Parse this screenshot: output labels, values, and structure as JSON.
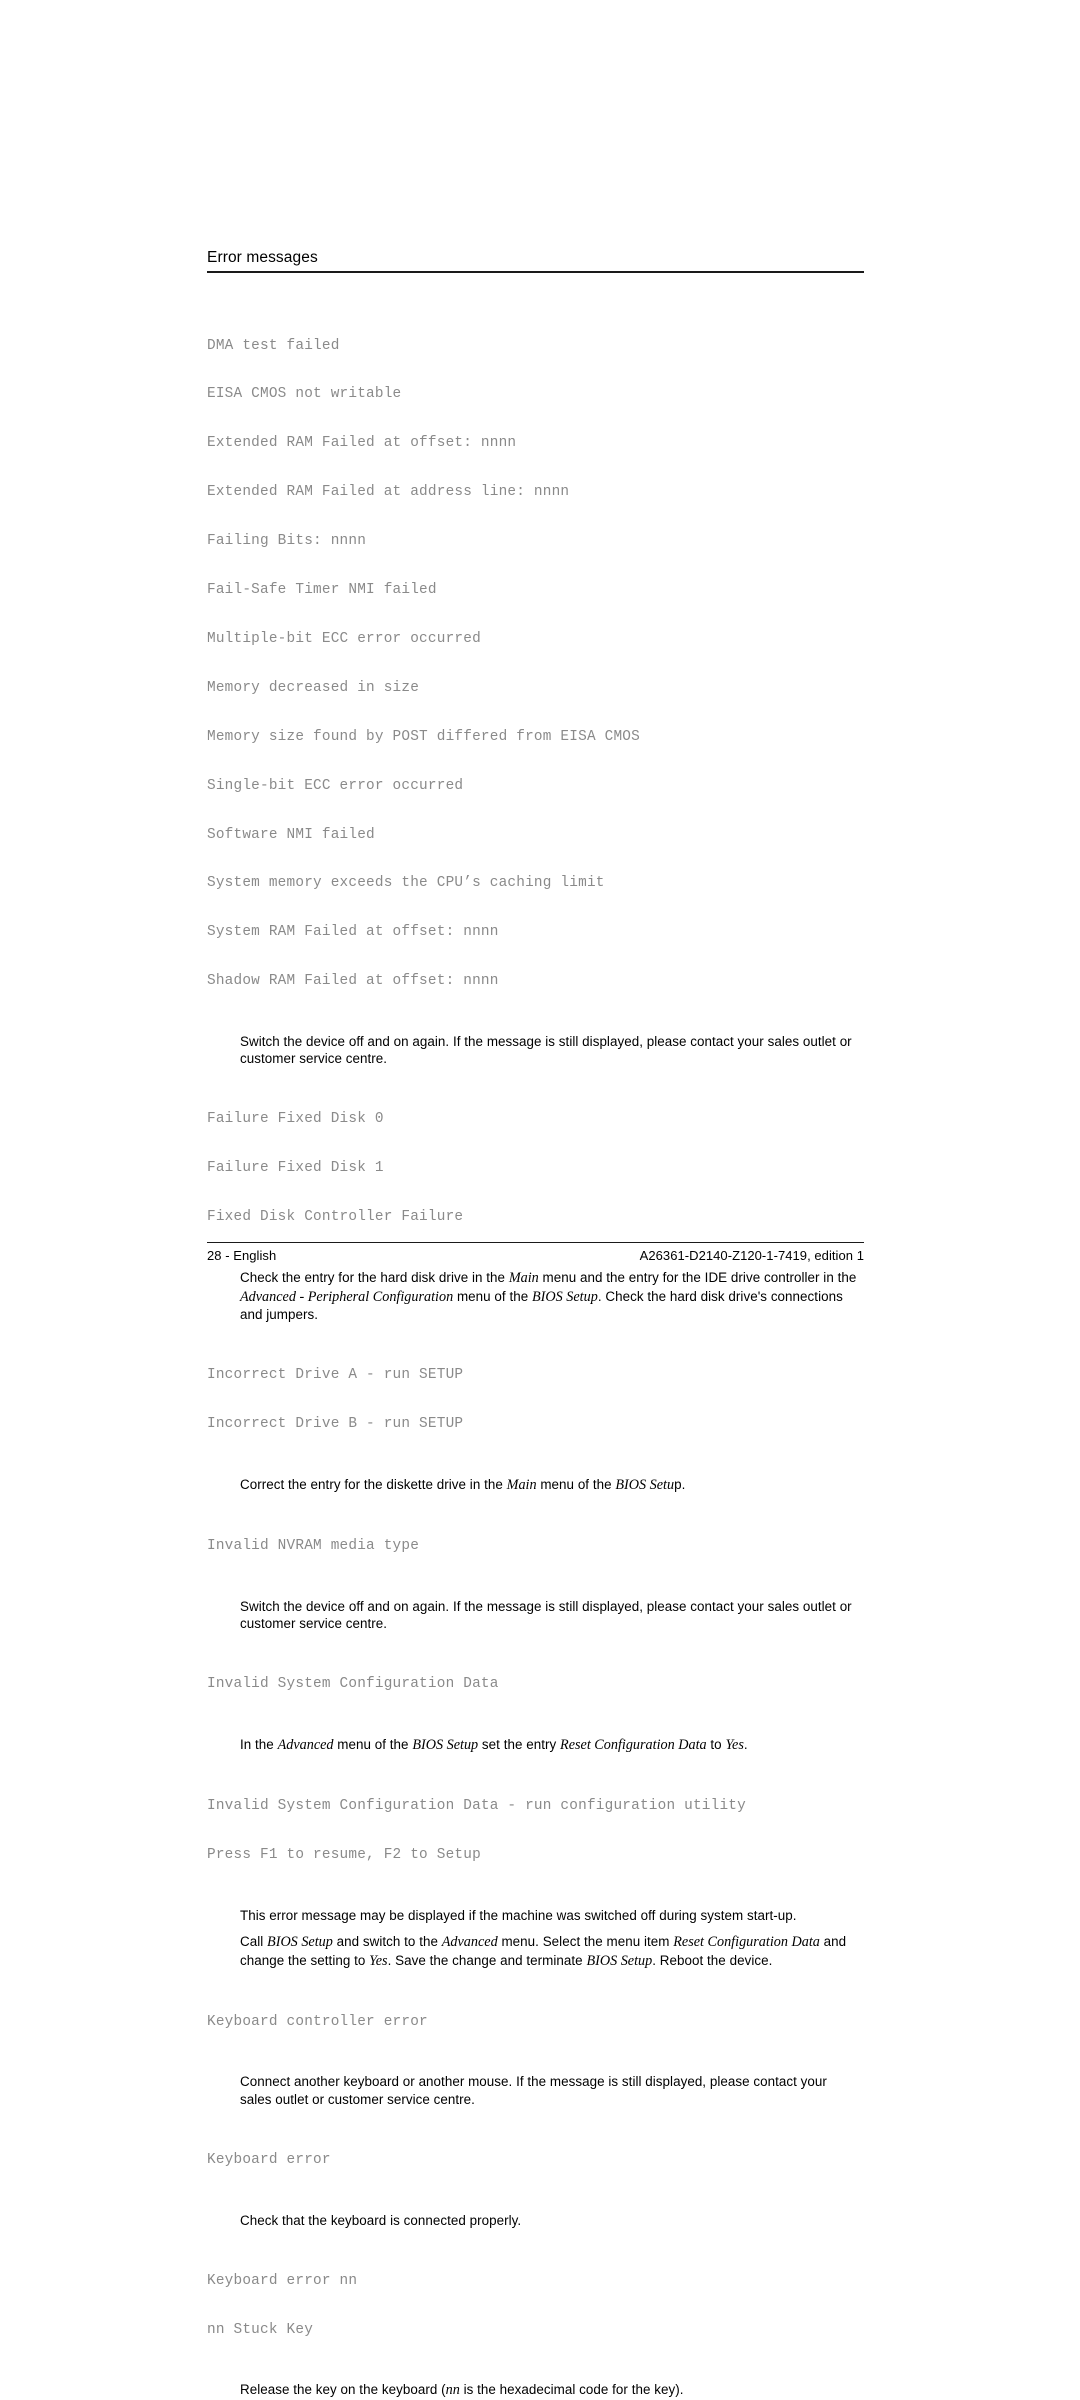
{
  "header": {
    "title": "Error messages"
  },
  "blocks": {
    "messages_1": [
      "DMA test failed",
      "EISA CMOS not writable",
      "Extended RAM Failed at offset: nnnn",
      "Extended RAM Failed at address line: nnnn",
      "Failing Bits: nnnn",
      "Fail-Safe Timer NMI failed",
      "Multiple-bit ECC error occurred",
      "Memory decreased in size",
      "Memory size found by POST differed from EISA CMOS",
      "Single-bit ECC error occurred",
      "Software NMI failed",
      "System memory exceeds the CPU’s caching limit",
      "System RAM Failed at offset: nnnn",
      "Shadow RAM Failed at offset: nnnn"
    ],
    "para_1": "Switch the device off and on again. If the message is still displayed, please contact your sales outlet or customer service centre.",
    "messages_2": [
      "Failure Fixed Disk 0",
      "Failure Fixed Disk 1",
      "Fixed Disk Controller Failure"
    ],
    "para_2": {
      "t1": "Check the entry for the hard disk drive in the ",
      "i1": "Main",
      "t2": " menu and the entry for the IDE drive controller in the ",
      "i2": "Advanced - Peripheral Configuration",
      "t3": " menu of the ",
      "i3": "BIOS Setup",
      "t4": ". Check the hard disk drive's connections and jumpers."
    },
    "messages_3": [
      "Incorrect Drive A - run SETUP",
      "Incorrect Drive B - run SETUP"
    ],
    "para_3": {
      "t1": "Correct the entry for the diskette drive in the ",
      "i1": "Main",
      "t2": " menu of the ",
      "i2": "BIOS Setu",
      "t3": "p."
    },
    "messages_4": [
      "Invalid NVRAM media type"
    ],
    "para_4": "Switch the device off and on again. If the message is still displayed, please contact your sales outlet or customer service centre.",
    "messages_5": [
      "Invalid System Configuration Data"
    ],
    "para_5": {
      "t1": "In the ",
      "i1": "Advanced",
      "t2": " menu of the ",
      "i2": "BIOS Setup",
      "t3": " set the entry ",
      "i3": "Reset Configuration Data",
      "t4": " to ",
      "i4": "Yes",
      "t5": "."
    },
    "messages_6": [
      "Invalid System Configuration Data - run configuration utility",
      "Press F1 to resume, F2 to Setup"
    ],
    "para_6": "This error message may be displayed if the machine was switched off during system start-up.",
    "para_7": {
      "t1": "Call ",
      "i1": "BIOS Setup",
      "t2": " and switch to the ",
      "i2": "Advanced",
      "t3": " menu. Select the menu item ",
      "i3": "Reset Configuration Data",
      "t4": " and change the setting to ",
      "i4": "Yes",
      "t5": ". Save the change and terminate ",
      "i5": "BIOS Setup",
      "t6": ". Reboot the device."
    },
    "messages_7": [
      "Keyboard controller error"
    ],
    "para_8": "Connect another keyboard or another mouse. If the message is still displayed, please contact your sales outlet or customer service centre.",
    "messages_8": [
      "Keyboard error"
    ],
    "para_9": "Check that the keyboard is connected properly.",
    "messages_9": [
      "Keyboard error nn",
      "nn Stuck Key"
    ],
    "para_10": {
      "t1": "Release the key on the keyboard (",
      "i1": "nn",
      "t2": " is the hexadecimal code for the key)."
    }
  },
  "footer": {
    "page_label": "28 - English",
    "document_id": "A26361-D2140-Z120-1-7419, edition 1"
  }
}
